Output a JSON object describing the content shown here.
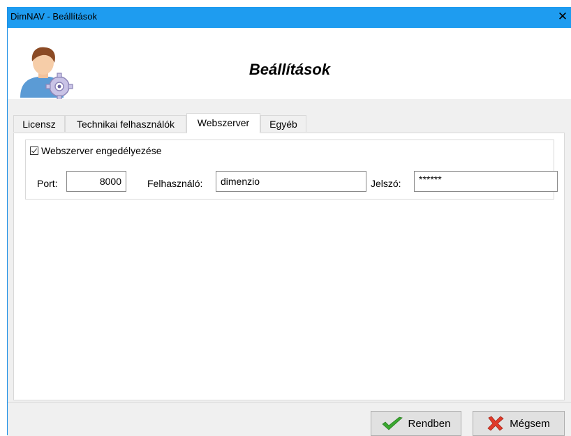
{
  "window": {
    "title": "DimNAV - Beállítások",
    "close_glyph": "✕"
  },
  "header": {
    "heading": "Beállítások",
    "icon": "user-settings-icon"
  },
  "tabs": [
    {
      "label": "Licensz",
      "active": false
    },
    {
      "label": "Technikai felhasználók",
      "active": false
    },
    {
      "label": "Webszerver",
      "active": true
    },
    {
      "label": "Egyéb",
      "active": false
    }
  ],
  "webserver": {
    "enable_label": "Webszerver engedélyezése",
    "enabled": true,
    "port_label": "Port:",
    "port_value": "8000",
    "user_label": "Felhasználó:",
    "user_value": "dimenzio",
    "password_label": "Jelszó:",
    "password_value": "******"
  },
  "buttons": {
    "ok_label": "Rendben",
    "cancel_label": "Mégsem"
  },
  "colors": {
    "titlebar": "#1e9cf0",
    "ok_check": "#3aa830",
    "cancel_x": "#e03a2a"
  }
}
